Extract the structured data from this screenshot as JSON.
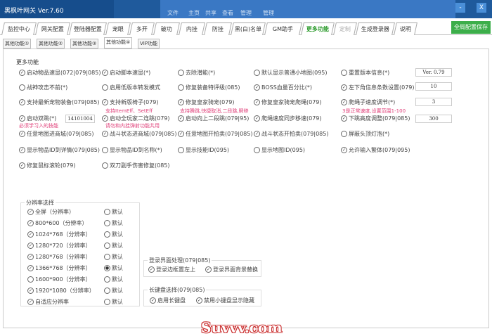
{
  "app_title": "黑枫叶网关 Ver.7.60",
  "ribbon": [
    "文件",
    "主页",
    "共享",
    "查看",
    "管理",
    "管理"
  ],
  "window": {
    "minimize": "-",
    "close": "X"
  },
  "tabs": [
    "监控中心",
    "网关配置",
    "登陆器配置",
    "宠眼",
    "多开",
    "破功",
    "内挂",
    "防挂",
    "黑(白)名单",
    "GM助手",
    "更多功能",
    "定制",
    "生成登录器",
    "说明"
  ],
  "save_button": "全局配置保存",
  "subtabs": [
    "其他功能①",
    "其他功能②",
    "其他功能③",
    "其他功能④",
    "VIP功能"
  ],
  "more_title": "更多功能",
  "options": [
    {
      "label": "启动物品速显(072|079|085)",
      "checked": true
    },
    {
      "label": "启动脚本速显(*)",
      "checked": true
    },
    {
      "label": "去除潜能(*)",
      "checked": false
    },
    {
      "label": "默认显示普通小地图(095)",
      "checked": false
    },
    {
      "label": "重置版本信息(*)",
      "checked": false
    },
    {
      "label": "战神攻击不前(*)",
      "checked": false
    },
    {
      "label": "启用低版本转发模式",
      "checked": false
    },
    {
      "label": "修复装备特评级(085)",
      "checked": false
    },
    {
      "label": "BOSS血量百分比(*)",
      "checked": true
    },
    {
      "label": "左下角信息条数设置(079)",
      "checked": true
    },
    {
      "label": "支持最新宠物装备(079|085)",
      "checked": true
    },
    {
      "label": "支持新版椅子(079)",
      "checked": true
    },
    {
      "label": "修复皇家骑宠(079)",
      "checked": true
    },
    {
      "label": "修复皇家骑宠爬绳(079)",
      "checked": true
    },
    {
      "label": "爬绳子速度调节(*)",
      "checked": true
    },
    {
      "label": "启动双跳(*)",
      "checked": true
    },
    {
      "label": "启动全玩家二连跳(079)",
      "checked": true
    },
    {
      "label": "启动向上二段跳(079|95)",
      "checked": true
    },
    {
      "label": "爬绳速度同步移速(079)",
      "checked": true
    },
    {
      "label": "下跳高度调整(079|085)",
      "checked": true
    },
    {
      "label": "任意地图进商城(079|085)",
      "checked": true
    },
    {
      "label": "战斗状态进商城(079|085)",
      "checked": true
    },
    {
      "label": "任意地图开拍卖(079|085)",
      "checked": true
    },
    {
      "label": "战斗状态开拍卖(079|085)",
      "checked": true
    },
    {
      "label": "屏蔽头顶灯泡(*)",
      "checked": false
    },
    {
      "label": "显示物品ID到详情(079|085)",
      "checked": true
    },
    {
      "label": "显示物品ID到名称(*)",
      "checked": false
    },
    {
      "label": "显示技能ID(095)",
      "checked": false
    },
    {
      "label": "显示地图ID(095)",
      "checked": false
    },
    {
      "label": "允许输入繁体(079|095)",
      "checked": true
    },
    {
      "label": "修复鼠标滚轮(079)",
      "checked": true
    },
    {
      "label": "双刀副手伤害修复(085)",
      "checked": false
    }
  ],
  "inputs": {
    "version": "Ver. 0.79",
    "info_count": "10",
    "rope_speed": "3",
    "jump_height": "300",
    "double_jump_skill": "14101004"
  },
  "notes": {
    "chair": "支持ItemEff、SetEff",
    "royal": "支持腾跳,快捷取消,二段跳,瞬移",
    "rope": "3是正常速度,设置范围1-100",
    "skill": "必须学习入的技能",
    "conflict": "请勿和内挂弹射功能共用"
  },
  "resolution": {
    "title": "分辨率选择",
    "items": [
      {
        "label": "全屏（分辨率）",
        "checked": true,
        "default": false
      },
      {
        "label": "800*600（分辨率）",
        "checked": true,
        "default": false
      },
      {
        "label": "1024*768（分辨率）",
        "checked": true,
        "default": false
      },
      {
        "label": "1280*720（分辨率）",
        "checked": true,
        "default": false
      },
      {
        "label": "1280*768（分辨率）",
        "checked": true,
        "default": false
      },
      {
        "label": "1366*768（分辨率）",
        "checked": true,
        "default": true
      },
      {
        "label": "1600*900（分辨率）",
        "checked": false,
        "default": false
      },
      {
        "label": "1920*1080（分辨率）",
        "checked": true,
        "default": false
      },
      {
        "label": "自适应分辨率",
        "checked": true,
        "default": false
      }
    ],
    "default_label": "默认"
  },
  "login": {
    "title": "登录界面处理(079|085)",
    "opt1": "登录边框置左上",
    "opt2": "登录界面背景替换"
  },
  "keyboard": {
    "title": "长键盘选择(079|085)",
    "opt1": "启用长键盘",
    "opt2": "禁用小键盘显示隐藏"
  },
  "watermark": "Suvvv.com"
}
